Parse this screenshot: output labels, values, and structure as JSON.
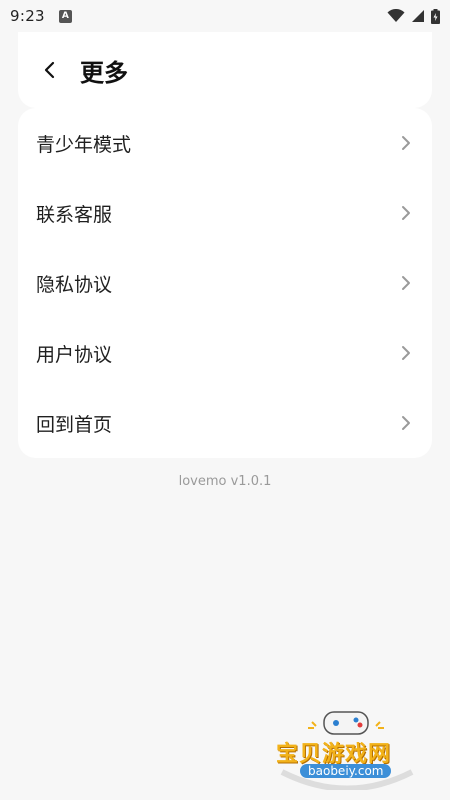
{
  "status_bar": {
    "time": "9:23",
    "app_icon_letter": "A"
  },
  "header": {
    "title": "更多"
  },
  "menu": {
    "items": [
      {
        "label": "青少年模式"
      },
      {
        "label": "联系客服"
      },
      {
        "label": "隐私协议"
      },
      {
        "label": "用户协议"
      },
      {
        "label": "回到首页"
      }
    ]
  },
  "version": "lovemo v1.0.1",
  "watermark": {
    "text": "宝贝游戏网",
    "url": "baobeiy.com"
  }
}
